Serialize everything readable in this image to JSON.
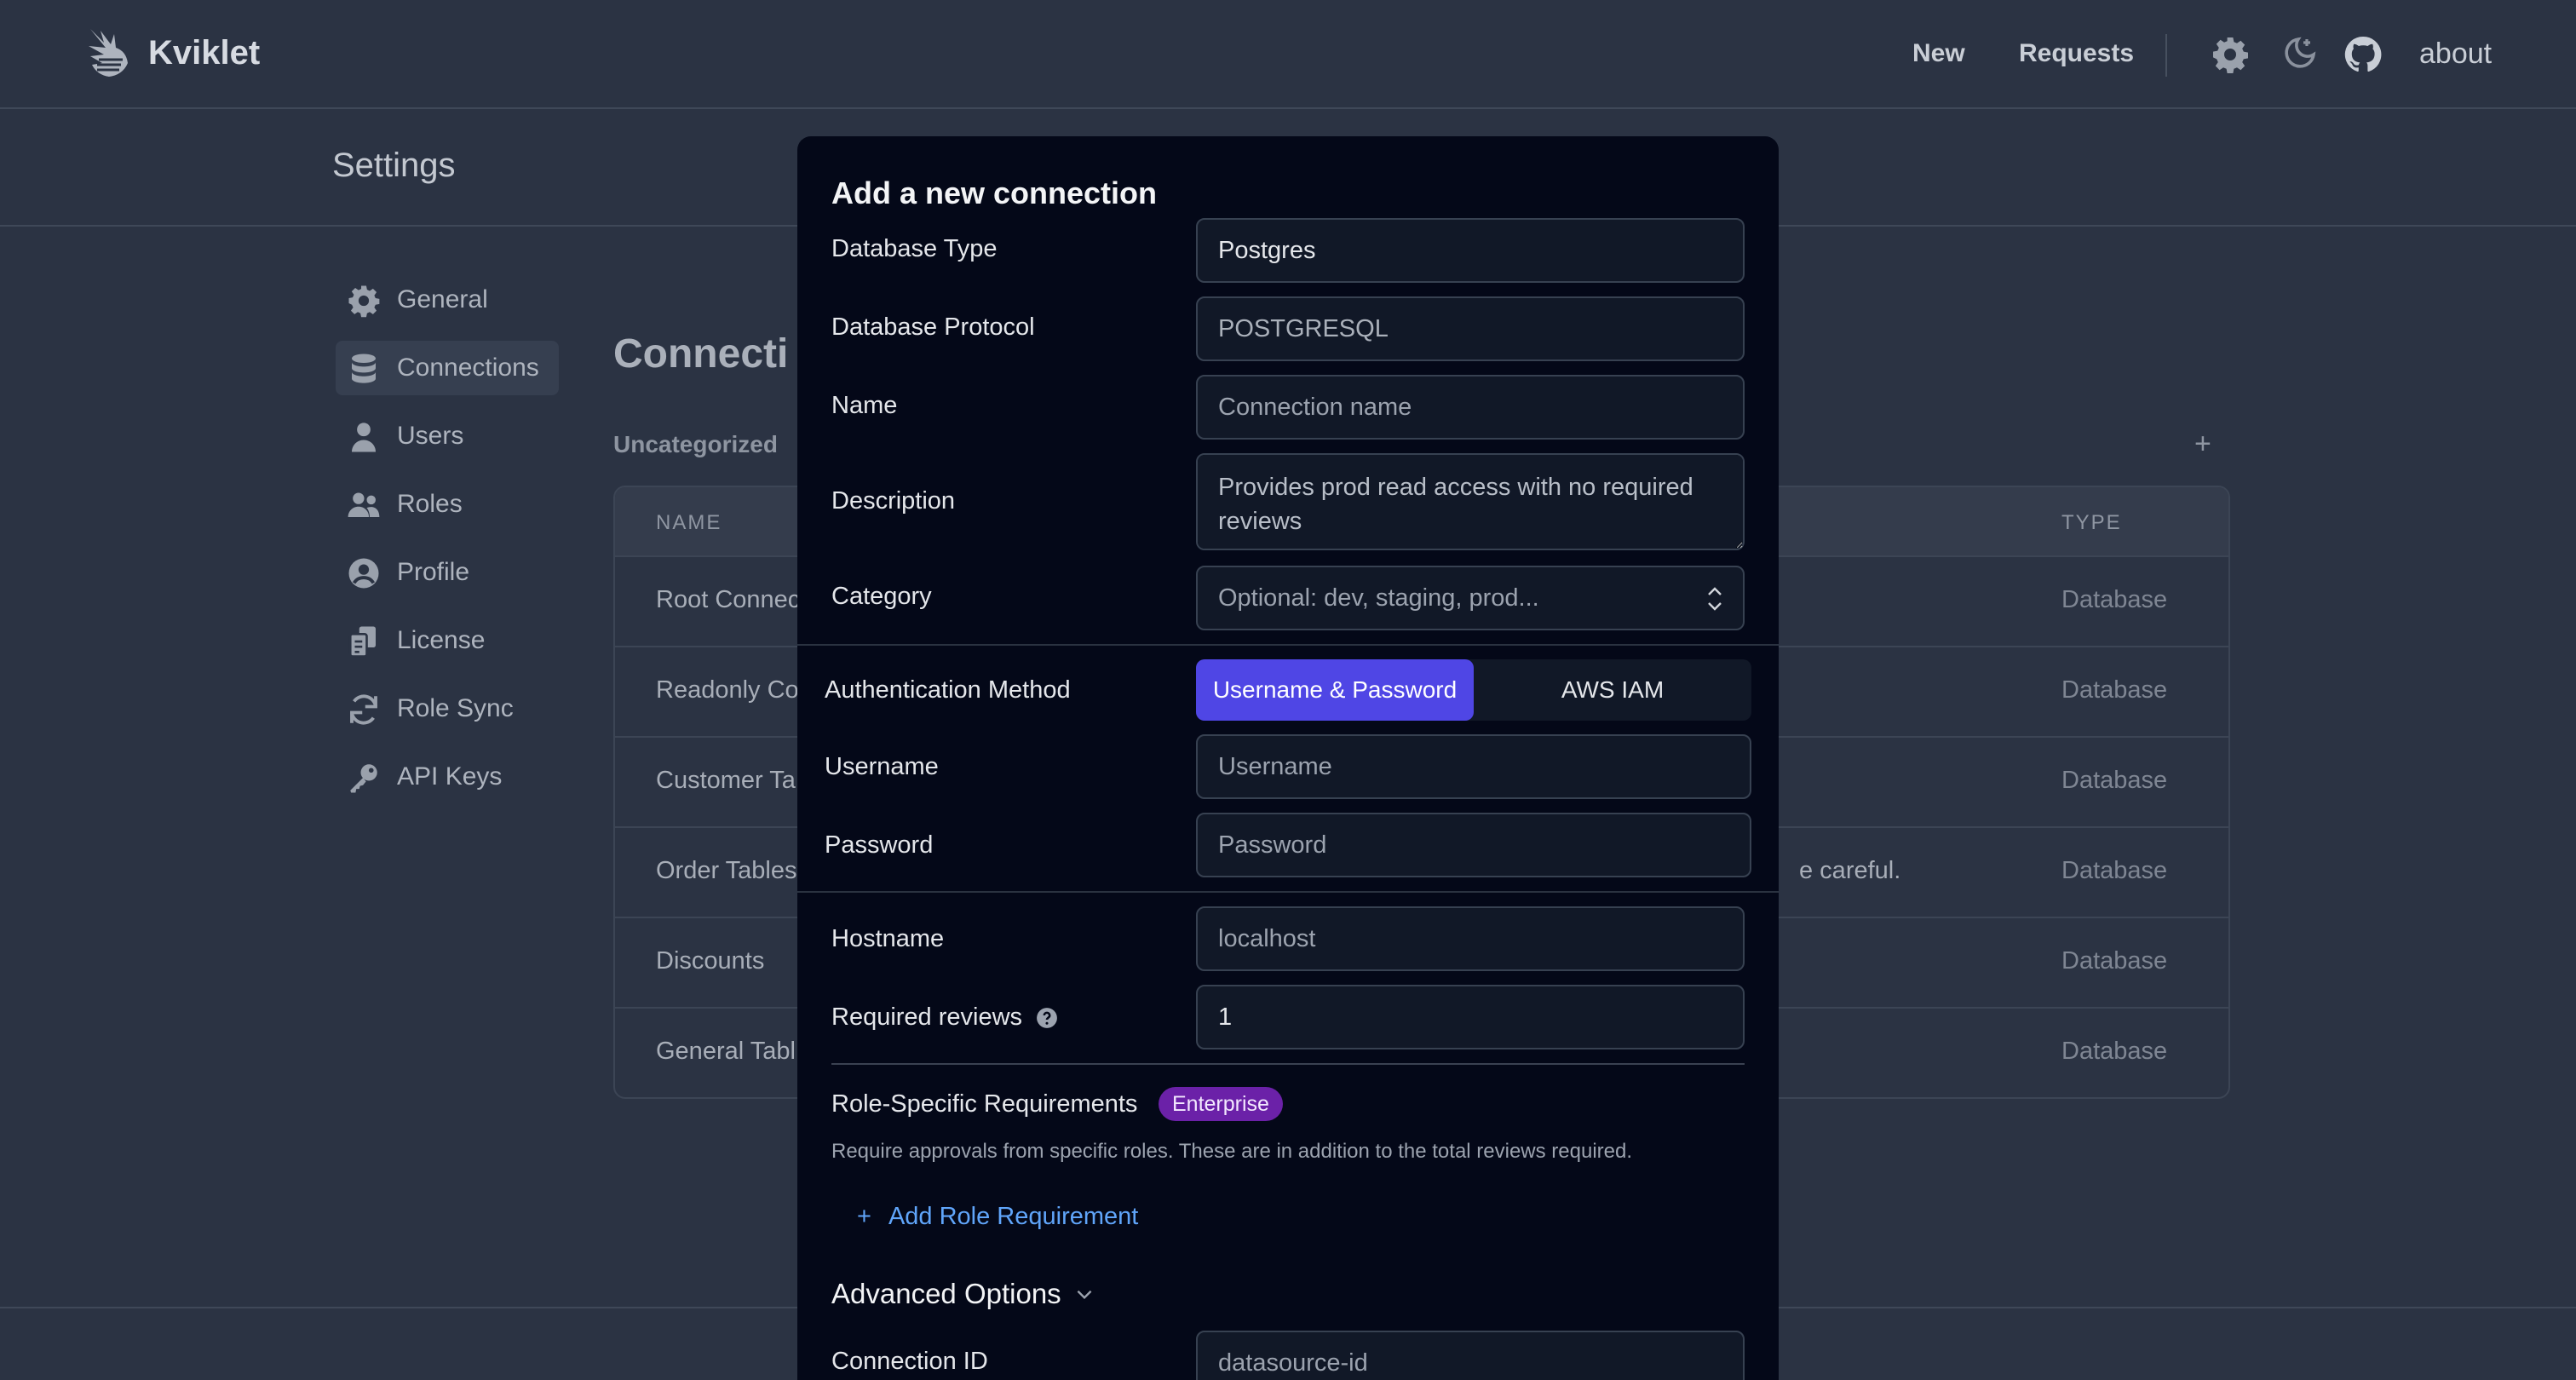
{
  "brand": {
    "name": "Kviklet"
  },
  "topnav": {
    "new": "New",
    "requests": "Requests",
    "about": "about"
  },
  "settings": {
    "title": "Settings"
  },
  "sidebar": {
    "items": [
      {
        "label": "General",
        "icon": "gear-icon"
      },
      {
        "label": "Connections",
        "icon": "database-icon"
      },
      {
        "label": "Users",
        "icon": "user-icon"
      },
      {
        "label": "Roles",
        "icon": "users-icon"
      },
      {
        "label": "Profile",
        "icon": "profile-icon"
      },
      {
        "label": "License",
        "icon": "license-icon"
      },
      {
        "label": "Role Sync",
        "icon": "sync-icon"
      },
      {
        "label": "API Keys",
        "icon": "key-icon"
      }
    ]
  },
  "page": {
    "heading": "Connecti",
    "group": "Uncategorized",
    "plus": "+",
    "table": {
      "headers": {
        "name": "NAME",
        "type": "TYPE"
      },
      "rows": [
        {
          "name": "Root Connec",
          "desc": "",
          "type": "Database"
        },
        {
          "name": "Readonly Co",
          "desc": "",
          "type": "Database"
        },
        {
          "name": "Customer Ta",
          "desc": "",
          "type": "Database"
        },
        {
          "name": "Order Tables",
          "desc": "e careful.",
          "type": "Database"
        },
        {
          "name": "Discounts",
          "desc": "",
          "type": "Database"
        },
        {
          "name": "General Tabl",
          "desc": "",
          "type": "Database"
        }
      ]
    }
  },
  "modal": {
    "title": "Add a new connection",
    "db_type_label": "Database Type",
    "db_type_value": "Postgres",
    "db_protocol_label": "Database Protocol",
    "db_protocol_value": "POSTGRESQL",
    "name_label": "Name",
    "name_placeholder": "Connection name",
    "description_label": "Description",
    "description_value": "Provides prod read access with no required reviews",
    "category_label": "Category",
    "category_placeholder": "Optional: dev, staging, prod...",
    "auth_label": "Authentication Method",
    "auth_options": {
      "userpass": "Username & Password",
      "iam": "AWS IAM"
    },
    "username_label": "Username",
    "username_placeholder": "Username",
    "password_label": "Password",
    "password_placeholder": "Password",
    "hostname_label": "Hostname",
    "hostname_placeholder": "localhost",
    "reviews_label": "Required reviews",
    "reviews_value": "1",
    "role_req_label": "Role-Specific Requirements",
    "role_req_badge": "Enterprise",
    "role_req_hint": "Require approvals from specific roles. These are in addition to the total reviews required.",
    "add_role_plus": "+",
    "add_role_label": "Add Role Requirement",
    "advanced_label": "Advanced Options",
    "connection_id_label": "Connection ID",
    "connection_id_placeholder": "datasource-id"
  },
  "colors": {
    "accent": "#4f46e5",
    "badge": "#6b21a8",
    "link": "#60a5fa",
    "modal_bg": "#040818",
    "page_bg": "#2b3343"
  }
}
